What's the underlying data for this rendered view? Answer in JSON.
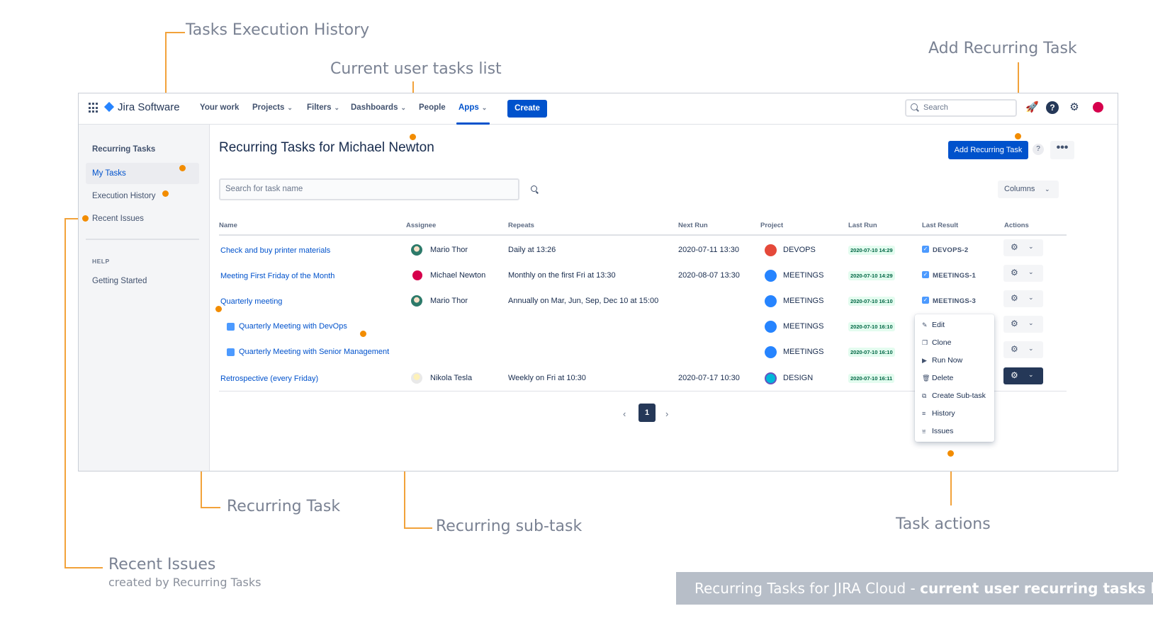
{
  "callouts": {
    "execution_history": "Tasks Execution History",
    "current_list": "Current user tasks list",
    "add_task": "Add Recurring Task",
    "recurring_task": "Recurring Task",
    "recurring_subtask": "Recurring sub-task",
    "task_actions": "Task actions",
    "recent_issues": "Recent Issues",
    "recent_issues_sub": "created by Recurring Tasks"
  },
  "footer": {
    "prefix": "Recurring Tasks for JIRA Cloud - ",
    "emphasis": "current user recurring tasks list"
  },
  "topnav": {
    "logo": "Jira Software",
    "items": [
      "Your work",
      "Projects",
      "Filters",
      "Dashboards",
      "People",
      "Apps"
    ],
    "create": "Create",
    "search_placeholder": "Search",
    "help": "?"
  },
  "sidebar": {
    "title": "Recurring Tasks",
    "items": [
      "My Tasks",
      "Execution History",
      "Recent Issues"
    ],
    "help_heading": "HELP",
    "help_items": [
      "Getting Started"
    ]
  },
  "main": {
    "title": "Recurring Tasks for Michael Newton",
    "add_button": "Add Recurring Task",
    "help_button": "?",
    "more_button": "•••",
    "search_placeholder": "Search for task name",
    "columns_button": "Columns"
  },
  "table": {
    "headers": [
      "Name",
      "Assignee",
      "Repeats",
      "Next Run",
      "Project",
      "Last Run",
      "Last Result",
      "Actions"
    ],
    "rows": [
      {
        "name": "Check and buy printer materials",
        "assignee": "Mario Thor",
        "repeats": "Daily at 13:26",
        "next_run": "2020-07-11 13:30",
        "project": "DEVOPS",
        "last_run": "2020-07-10 14:29",
        "last_result": "DEVOPS-2"
      },
      {
        "name": "Meeting First Friday of the Month",
        "assignee": "Michael Newton",
        "repeats": "Monthly on the first Fri at 13:30",
        "next_run": "2020-08-07 13:30",
        "project": "MEETINGS",
        "last_run": "2020-07-10 14:29",
        "last_result": "MEETINGS-1"
      },
      {
        "name": "Quarterly meeting",
        "assignee": "Mario Thor",
        "repeats": "Annually on Mar, Jun, Sep, Dec 10 at 15:00",
        "next_run": "",
        "project": "MEETINGS",
        "last_run": "2020-07-10 16:10",
        "last_result": "MEETINGS-3"
      },
      {
        "name": "Quarterly Meeting with DevOps",
        "assignee": "",
        "repeats": "",
        "next_run": "",
        "project": "MEETINGS",
        "last_run": "2020-07-10 16:10",
        "last_result": ""
      },
      {
        "name": "Quarterly Meeting with Senior Management",
        "assignee": "",
        "repeats": "",
        "next_run": "",
        "project": "MEETINGS",
        "last_run": "2020-07-10 16:10",
        "last_result": ""
      },
      {
        "name": "Retrospective (every Friday)",
        "assignee": "Nikola Tesla",
        "repeats": "Weekly on Fri at 10:30",
        "next_run": "2020-07-17 10:30",
        "project": "DESIGN",
        "last_run": "2020-07-10 16:11",
        "last_result": ""
      }
    ]
  },
  "action_menu": [
    "Edit",
    "Clone",
    "Run Now",
    "Delete",
    "Create Sub-task",
    "History",
    "Issues"
  ],
  "pagination": {
    "current": "1"
  },
  "colors": {
    "accent": "#0052cc",
    "callout_line": "#f28c00",
    "nav_dark": "#253858"
  }
}
